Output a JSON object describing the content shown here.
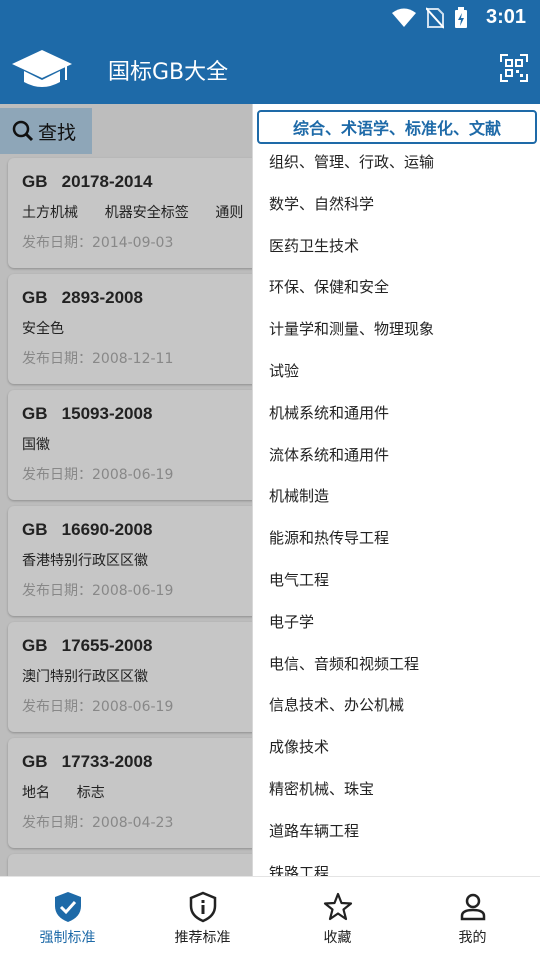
{
  "status_bar": {
    "time": "3:01"
  },
  "app_bar": {
    "title": "国标GB大全"
  },
  "search": {
    "label": "查找"
  },
  "cards": [
    {
      "code": "GB   20178-2014",
      "title": "土方机械      机器安全标签      通则",
      "date": "发布日期：2014-09-03"
    },
    {
      "code": "GB   2893-2008",
      "title": "安全色",
      "date": "发布日期：2008-12-11"
    },
    {
      "code": "GB   15093-2008",
      "title": "国徽",
      "date": "发布日期：2008-06-19"
    },
    {
      "code": "GB   16690-2008",
      "title": "香港特别行政区区徽",
      "date": "发布日期：2008-06-19"
    },
    {
      "code": "GB   17655-2008",
      "title": "澳门特别行政区区徽",
      "date": "发布日期：2008-06-19"
    },
    {
      "code": "GB   17733-2008",
      "title": "地名      标志",
      "date": "发布日期：2008-04-23"
    }
  ],
  "dropdown": {
    "selected": "综合、术语学、标准化、文献",
    "items": [
      "组织、管理、行政、运输",
      "数学、自然科学",
      "医药卫生技术",
      "环保、保健和安全",
      "计量学和测量、物理现象",
      "试验",
      "机械系统和通用件",
      "流体系统和通用件",
      "机械制造",
      "能源和热传导工程",
      "电气工程",
      "电子学",
      "电信、音频和视频工程",
      "信息技术、办公机械",
      "成像技术",
      "精密机械、珠宝",
      "道路车辆工程",
      "铁路工程"
    ]
  },
  "bottom_nav": [
    {
      "label": "强制标准",
      "icon": "shield-check-icon",
      "active": true
    },
    {
      "label": "推荐标准",
      "icon": "shield-info-icon",
      "active": false
    },
    {
      "label": "收藏",
      "icon": "star-icon",
      "active": false
    },
    {
      "label": "我的",
      "icon": "person-icon",
      "active": false
    }
  ],
  "colors": {
    "primary": "#1e6aa8",
    "overlay_bg": "#bdbdbd",
    "card_bg": "#c6c6c6"
  }
}
